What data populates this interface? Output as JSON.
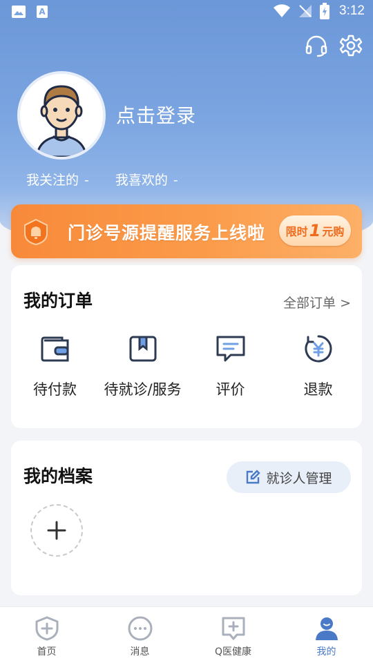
{
  "status_bar": {
    "time": "3:12"
  },
  "profile": {
    "login_text": "点击登录",
    "following_label": "我关注的",
    "following_value": "-",
    "liked_label": "我喜欢的",
    "liked_value": "-"
  },
  "banner": {
    "text": "门诊号源提醒服务上线啦",
    "pill_prefix": "限时",
    "pill_number": "1",
    "pill_suffix": "元购"
  },
  "orders": {
    "title": "我的订单",
    "all_link": "全部订单 >",
    "items": [
      {
        "label": "待付款",
        "icon": "wallet-icon"
      },
      {
        "label": "待就诊/服务",
        "icon": "bookmark-card-icon"
      },
      {
        "label": "评价",
        "icon": "comment-icon"
      },
      {
        "label": "退款",
        "icon": "yuan-refund-icon"
      }
    ]
  },
  "files": {
    "title": "我的档案",
    "manage_button": "就诊人管理"
  },
  "tabbar": {
    "tabs": [
      {
        "label": "首页",
        "icon": "shield-plus-icon",
        "active": false
      },
      {
        "label": "消息",
        "icon": "chat-dots-icon",
        "active": false
      },
      {
        "label": "Q医健康",
        "icon": "medical-plus-icon",
        "active": false
      },
      {
        "label": "我的",
        "icon": "user-icon",
        "active": true
      }
    ]
  },
  "colors": {
    "accent": "#4a79c7",
    "banner_orange": "#f78a3a",
    "hero_blue": "#6c97d8"
  }
}
